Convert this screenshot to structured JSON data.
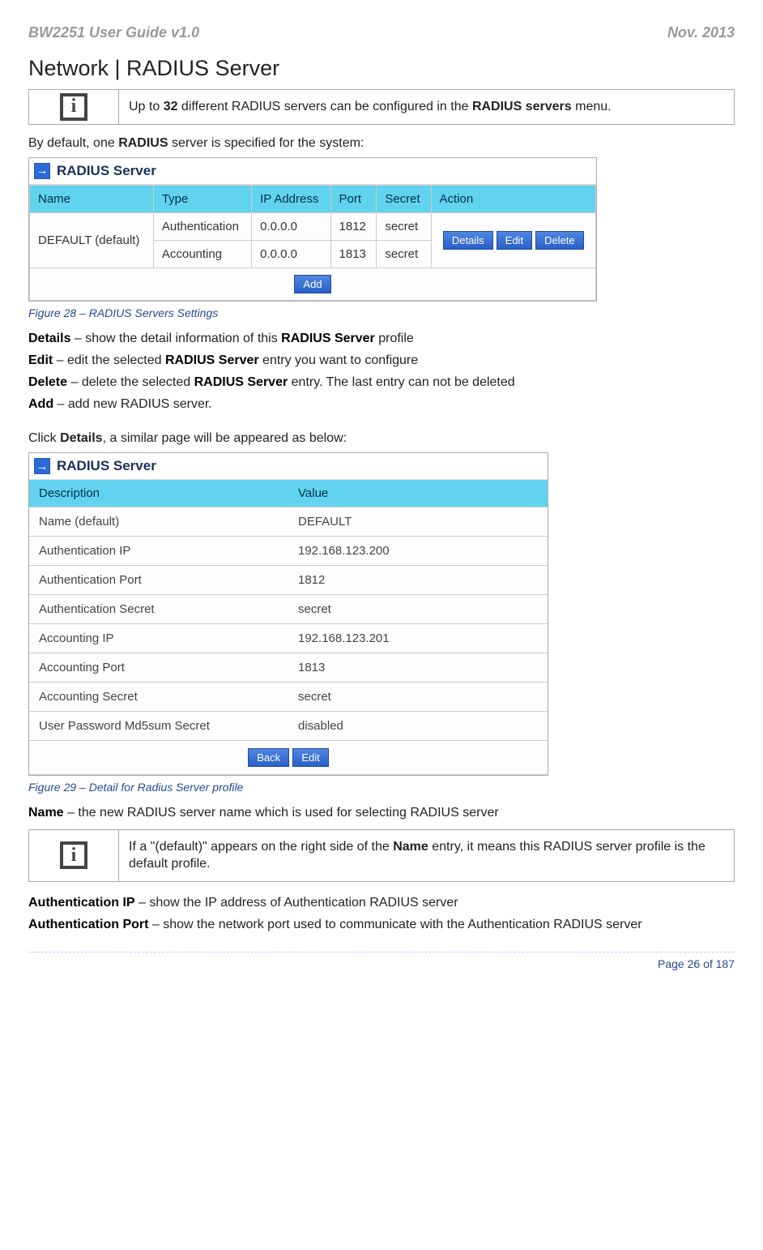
{
  "header": {
    "left": "BW2251 User Guide v1.0",
    "right": "Nov.  2013"
  },
  "section_title": "Network | RADIUS Server",
  "info1": {
    "pre": "Up to ",
    "bold1": "32",
    "mid": " different RADIUS servers can be configured in the ",
    "bold2": "RADIUS servers",
    "post": " menu."
  },
  "intro": {
    "pre": "By default, one ",
    "bold": "RADIUS",
    "post": " server is specified for the system:"
  },
  "panel_title": "RADIUS Server",
  "table1": {
    "headers": [
      "Name",
      "Type",
      "IP Address",
      "Port",
      "Secret",
      "Action"
    ],
    "name": "DEFAULT (default)",
    "rows": [
      {
        "type": "Authentication",
        "ip": "0.0.0.0",
        "port": "1812",
        "secret": "secret"
      },
      {
        "type": "Accounting",
        "ip": "0.0.0.0",
        "port": "1813",
        "secret": "secret"
      }
    ],
    "buttons": {
      "details": "Details",
      "edit": "Edit",
      "delete": "Delete",
      "add": "Add"
    }
  },
  "caption1": "Figure 28 – RADIUS Servers Settings",
  "defs1": [
    {
      "term": "Details",
      "sep": " – show the detail information of this ",
      "bold": "RADIUS Server",
      "rest": " profile"
    },
    {
      "term": "Edit",
      "sep": " – edit the selected ",
      "bold": "RADIUS Server",
      "rest": " entry you want to configure"
    },
    {
      "term": "Delete",
      "sep": " – delete the selected ",
      "bold": "RADIUS Server",
      "rest": " entry. The last entry can not be deleted"
    },
    {
      "term": "Add",
      "sep": " – add new RADIUS server.",
      "bold": "",
      "rest": ""
    }
  ],
  "click_line": {
    "pre": "Click ",
    "bold": "Details",
    "post": ", a similar page will be appeared as below:"
  },
  "table2": {
    "headers": [
      "Description",
      "Value"
    ],
    "rows": [
      [
        "Name   (default)",
        "DEFAULT"
      ],
      [
        "Authentication IP",
        "192.168.123.200"
      ],
      [
        "Authentication Port",
        "1812"
      ],
      [
        "Authentication Secret",
        "secret"
      ],
      [
        "Accounting IP",
        "192.168.123.201"
      ],
      [
        "Accounting Port",
        "1813"
      ],
      [
        "Accounting Secret",
        "secret"
      ],
      [
        "User Password Md5sum Secret",
        "disabled"
      ]
    ],
    "buttons": {
      "back": "Back",
      "edit": "Edit"
    }
  },
  "caption2": "Figure 29 – Detail for Radius Server profile",
  "name_def": {
    "term": "Name",
    "rest": " – the new RADIUS server name which is used for selecting RADIUS server"
  },
  "info2": {
    "pre": "If a \"(default)\" appears on the right side of the ",
    "bold": "Name",
    "post": " entry, it means this RADIUS server profile is the default profile."
  },
  "auth_defs": [
    {
      "term": "Authentication IP",
      "rest": " – show the IP address of Authentication RADIUS server"
    },
    {
      "term": "Authentication Port",
      "rest": " – show the network port used to communicate with the Authentication RADIUS server"
    }
  ],
  "footer": "Page 26 of 187"
}
